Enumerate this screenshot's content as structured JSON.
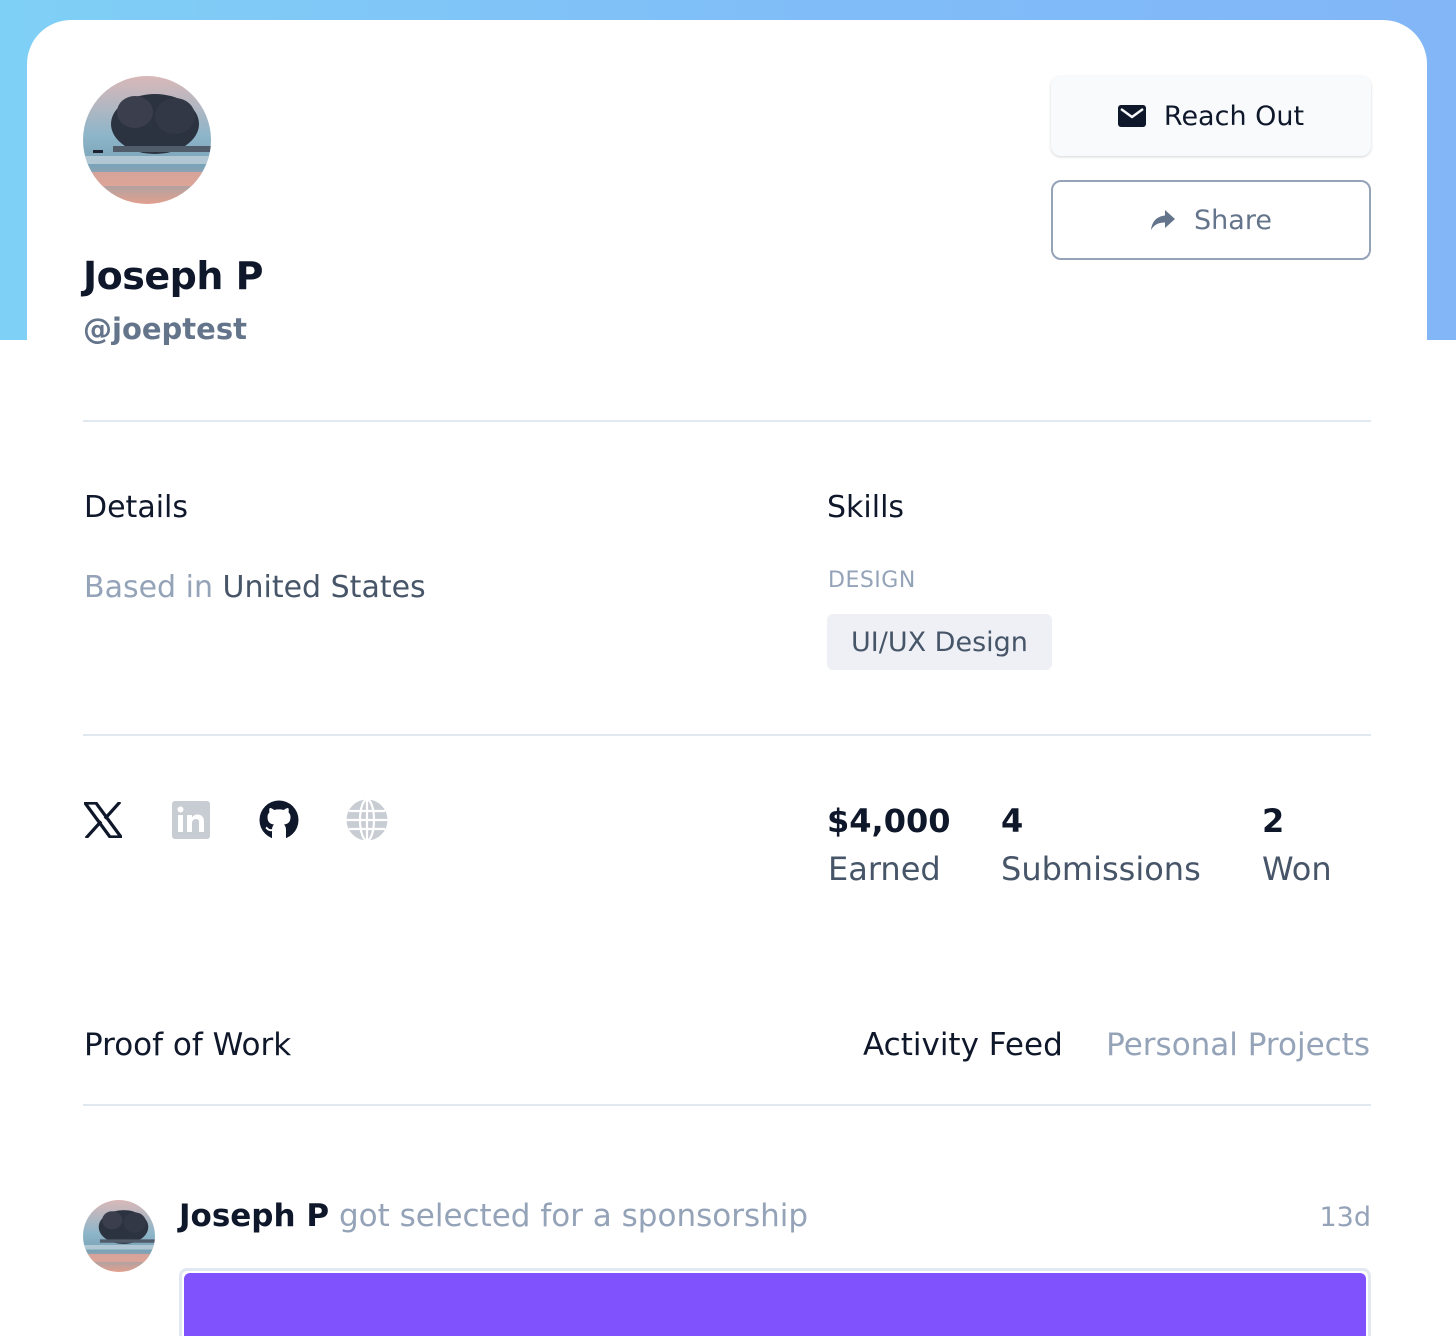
{
  "profile": {
    "name": "Joseph P",
    "handle": "@joeptest"
  },
  "actions": {
    "reach_out_label": "Reach Out",
    "share_label": "Share"
  },
  "details": {
    "title": "Details",
    "based_prefix": "Based in",
    "country": "United States"
  },
  "skills": {
    "title": "Skills",
    "category": "DESIGN",
    "items": [
      "UI/UX Design"
    ]
  },
  "socials": [
    {
      "icon": "x-twitter-icon",
      "active": true
    },
    {
      "icon": "linkedin-icon",
      "active": false
    },
    {
      "icon": "github-icon",
      "active": true
    },
    {
      "icon": "globe-icon",
      "active": false
    }
  ],
  "stats": [
    {
      "value": "$4,000",
      "label": "Earned"
    },
    {
      "value": "4",
      "label": "Submissions"
    },
    {
      "value": "2",
      "label": "Won"
    }
  ],
  "proof_of_work": {
    "title": "Proof of Work",
    "tabs": [
      {
        "label": "Activity Feed",
        "active": true
      },
      {
        "label": "Personal Projects",
        "active": false
      }
    ]
  },
  "feed": [
    {
      "user": "Joseph P",
      "action": "got selected for a sponsorship",
      "time": "13d",
      "card_color": "#8052fd"
    }
  ],
  "colors": {
    "banner_start": "#7fd0f6",
    "banner_end": "#82b6f7",
    "feed_card_accent": "#8052fd",
    "text_primary": "#0f172a",
    "text_muted": "#94a3b8"
  }
}
